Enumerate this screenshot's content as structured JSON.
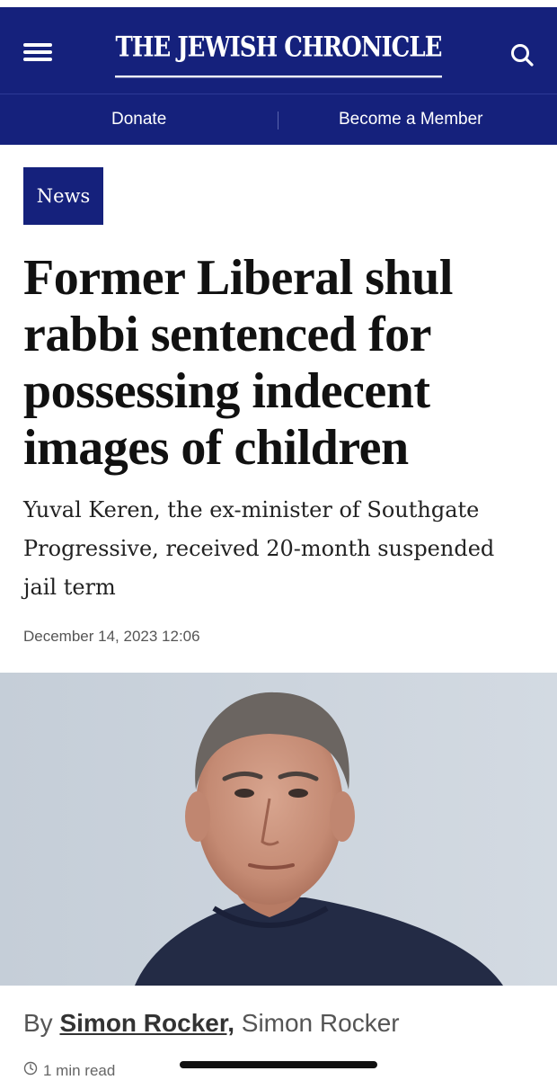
{
  "header": {
    "masthead": "THE JEWISH CHRONICLE",
    "menu_icon": "hamburger-menu-icon",
    "search_icon": "search-icon",
    "background_color": "#15217c"
  },
  "subnav": {
    "donate_label": "Donate",
    "member_label": "Become a Member"
  },
  "article": {
    "category": "News",
    "headline": "Former Liberal shul rabbi sentenced for possessing indecent images of children",
    "standfirst": "Yuval Keren, the ex-minister of Southgate Progressive, received 20-month suspended jail term",
    "date": "December 14, 2023 12:06",
    "byline_prefix": "By",
    "author_link": "Simon Rocker,",
    "author_name": "Simon Rocker",
    "read_time": "1 min read",
    "clock_icon": "clock-icon"
  }
}
